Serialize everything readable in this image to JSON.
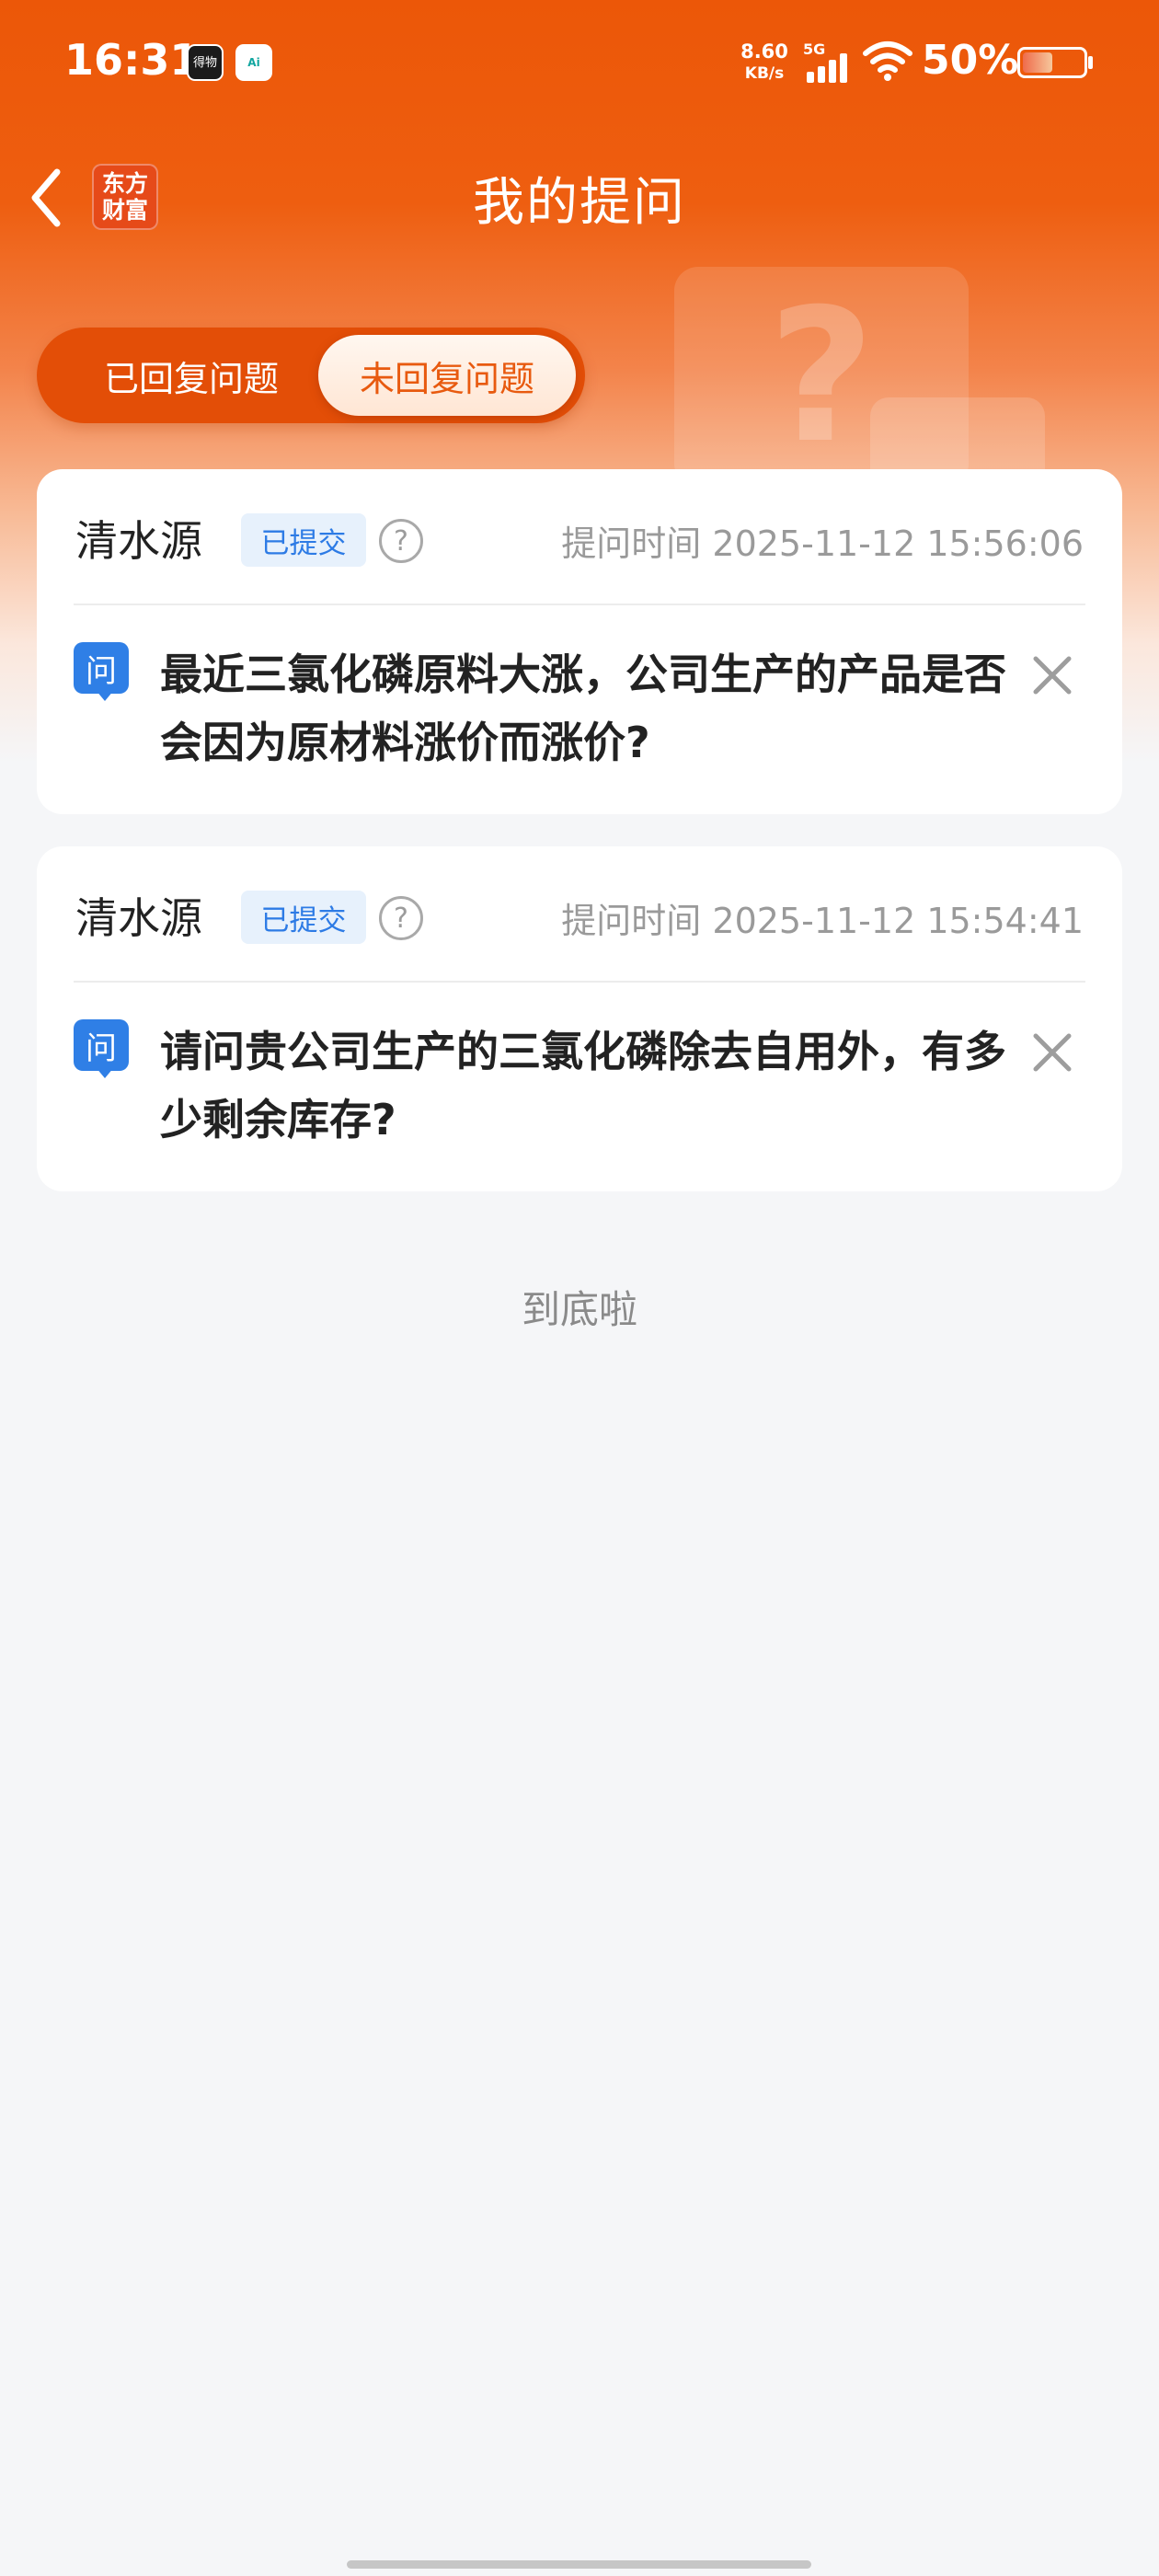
{
  "status_bar": {
    "time": "16:31",
    "app_icon_1": "得物",
    "app_icon_2": "Ai",
    "net_speed_value": "8.60",
    "net_speed_unit": "KB/s",
    "signal_label": "5G",
    "battery_percent": "50%",
    "battery_level": 0.5
  },
  "nav": {
    "title": "我的提问",
    "brand_line1": "东方",
    "brand_line2": "财富"
  },
  "tabs": {
    "replied_label": "已回复问题",
    "unreplied_label": "未回复问题",
    "active": "unreplied"
  },
  "questions": [
    {
      "user": "清水源",
      "status": "已提交",
      "time_label": "提问时间",
      "time": "2025-11-12 15:56:06",
      "tag": "问",
      "text": "最近三氯化磷原料大涨，公司生产的产品是否会因为原材料涨价而涨价?"
    },
    {
      "user": "清水源",
      "status": "已提交",
      "time_label": "提问时间",
      "time": "2025-11-12 15:54:41",
      "tag": "问",
      "text": "请问贵公司生产的三氯化磷除去自用外，有多少剩余库存?"
    }
  ],
  "footer": {
    "end_text": "到底啦"
  },
  "colors": {
    "brand_orange": "#ec5708",
    "badge_blue": "#2d7be5",
    "question_icon_blue": "#2f7fe6"
  }
}
